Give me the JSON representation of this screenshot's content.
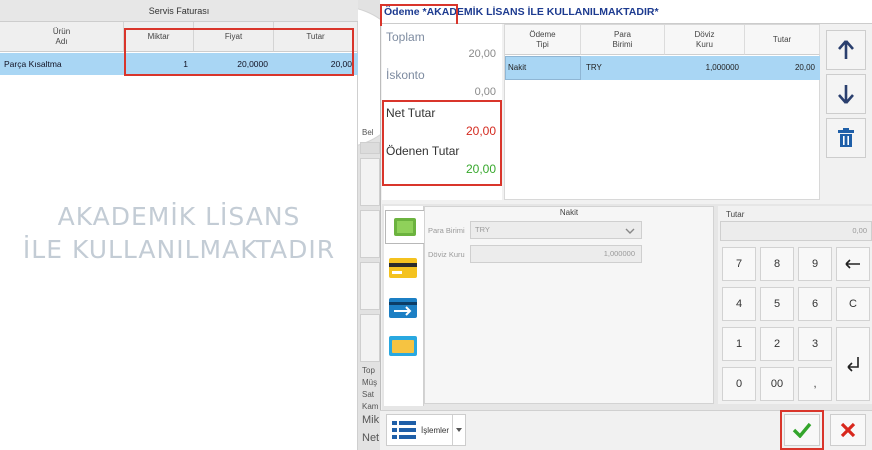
{
  "invoice": {
    "title": "Servis Faturası",
    "columns": [
      {
        "l1": "Ürün",
        "l2": "Adı"
      },
      {
        "l1": "Miktar",
        "l2": ""
      },
      {
        "l1": "Fiyat",
        "l2": ""
      },
      {
        "l1": "Tutar",
        "l2": ""
      }
    ],
    "row": {
      "name": "Parça Kısaltma",
      "qty": "1",
      "price": "20,0000",
      "total": "20,00"
    }
  },
  "watermark": {
    "line1": "AKADEMİK LİSANS",
    "line2": "İLE KULLANILMAKTADIR"
  },
  "ghost": {
    "t1": "Bel",
    "t2": "Top",
    "t3": "Müş",
    "t4": "Sat",
    "t5": "Kam",
    "t6": "Mik",
    "t7": "Net"
  },
  "payment": {
    "title": "Ödeme *AKADEMİK LİSANS İLE KULLANILMAKTADIR*",
    "summary": {
      "toplam_label": "Toplam",
      "toplam_value": "20,00",
      "iskonto_label": "İskonto",
      "iskonto_value": "0,00",
      "net_label": "Net Tutar",
      "net_value": "20,00",
      "odenen_label": "Ödenen Tutar",
      "odenen_value": "20,00"
    },
    "grid_columns": [
      {
        "l1": "Ödeme",
        "l2": "Tipi"
      },
      {
        "l1": "Para",
        "l2": "Birimi"
      },
      {
        "l1": "Döviz",
        "l2": "Kuru"
      },
      {
        "l1": "Tutar",
        "l2": ""
      }
    ],
    "grid_row": {
      "type": "Nakit",
      "currency": "TRY",
      "rate": "1,000000",
      "amount": "20,00"
    },
    "nakit": {
      "title": "Nakit",
      "currency_label": "Para Birimi",
      "currency_value": "TRY",
      "rate_label": "Döviz Kuru",
      "rate_value": "1,000000"
    },
    "tutar": {
      "title": "Tutar",
      "value": "0,00"
    },
    "keypad": [
      "7",
      "8",
      "9",
      "4",
      "5",
      "6",
      "1",
      "2",
      "3",
      "0",
      "00",
      ","
    ],
    "keypad_clear": "C",
    "ops_label": "İşlemler"
  },
  "colors": {
    "highlight": "#a9d6f4",
    "red_box": "#d9352b",
    "net": "#d42a1f",
    "paid": "#37a82c",
    "title": "#1d3b90"
  }
}
